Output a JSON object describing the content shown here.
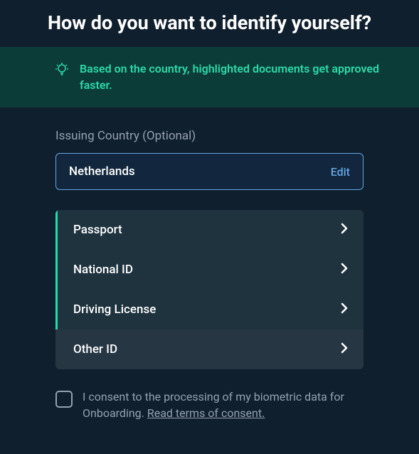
{
  "header": {
    "title": "How do you want to identify yourself?"
  },
  "banner": {
    "text": "Based on the country, highlighted documents get approved faster."
  },
  "country": {
    "label": "Issuing Country (Optional)",
    "value": "Netherlands",
    "edit_label": "Edit"
  },
  "documents": {
    "passport": "Passport",
    "national_id": "National ID",
    "driving_license": "Driving License",
    "other_id": "Other ID"
  },
  "consent": {
    "text_part1": "I consent to the processing of my biometric data for Onboarding. ",
    "link_text": "Read terms of consent."
  },
  "colors": {
    "accent_green": "#2bd9a8",
    "accent_blue": "#66a4e3"
  }
}
